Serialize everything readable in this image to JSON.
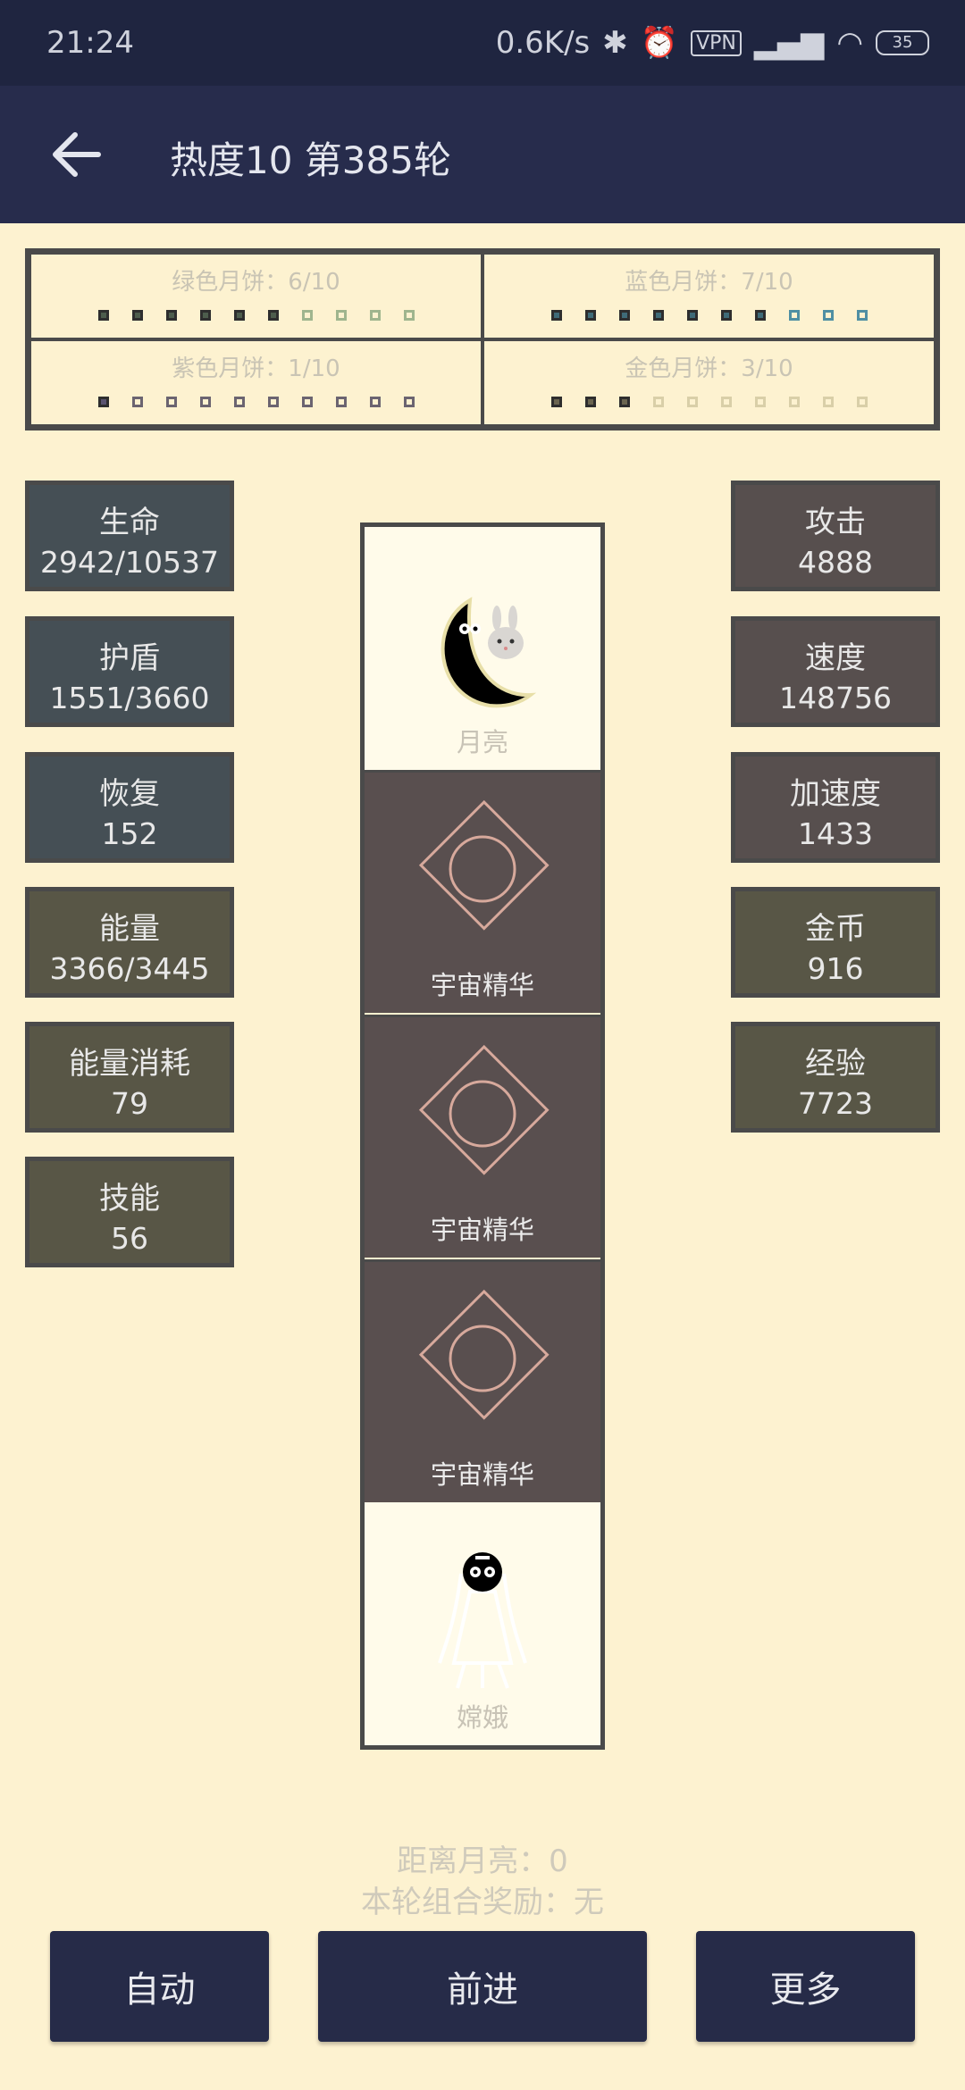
{
  "status": {
    "time": "21:24",
    "net": "0.6K/s",
    "battery": "35"
  },
  "header": {
    "title": "热度10 第385轮"
  },
  "cakes": [
    {
      "label": "绿色月饼：6/10",
      "filled": 6,
      "color": "#4d5d4d",
      "empty_color": "#9fb58e"
    },
    {
      "label": "蓝色月饼：7/10",
      "filled": 7,
      "color": "#3f6b78",
      "empty_color": "#4f8fa3"
    },
    {
      "label": "紫色月饼：1/10",
      "filled": 1,
      "color": "#5a5470",
      "empty_color": "#6b6470"
    },
    {
      "label": "金色月饼：3/10",
      "filled": 3,
      "color": "#6a6550",
      "empty_color": "#d9cfa8"
    }
  ],
  "left_stats": [
    {
      "name": "生命",
      "value": "2942/10537"
    },
    {
      "name": "护盾",
      "value": "1551/3660"
    },
    {
      "name": "恢复",
      "value": "152"
    },
    {
      "name": "能量",
      "value": "3366/3445"
    },
    {
      "name": "能量消耗",
      "value": "79"
    },
    {
      "name": "技能",
      "value": "56"
    }
  ],
  "right_stats": [
    {
      "name": "攻击",
      "value": "4888"
    },
    {
      "name": "速度",
      "value": "148756"
    },
    {
      "name": "加速度",
      "value": "1433"
    },
    {
      "name": "金币",
      "value": "916"
    },
    {
      "name": "经验",
      "value": "7723"
    }
  ],
  "track": [
    {
      "label": "月亮"
    },
    {
      "label": "宇宙精华"
    },
    {
      "label": "宇宙精华"
    },
    {
      "label": "宇宙精华"
    },
    {
      "label": "嫦娥"
    }
  ],
  "info": {
    "distance": "距离月亮：0",
    "bonus": "本轮组合奖励：无"
  },
  "buttons": {
    "auto": "自动",
    "forward": "前进",
    "more": "更多"
  }
}
